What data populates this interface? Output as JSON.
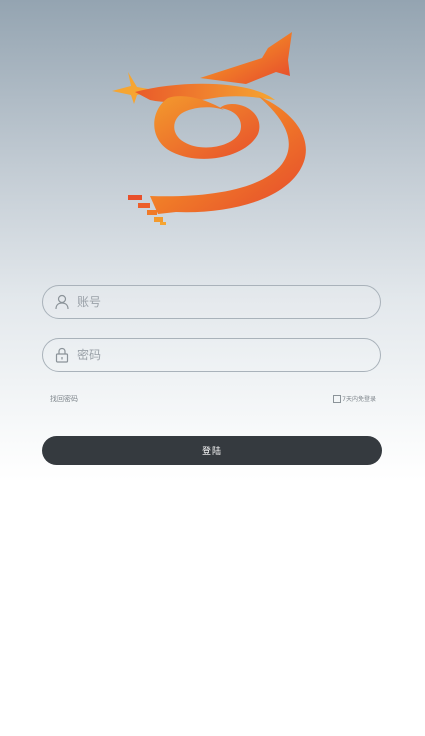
{
  "logo": {
    "icon": "swirl-star-logo",
    "colors": [
      "#f7a230",
      "#ef6a2a",
      "#e8492c"
    ]
  },
  "form": {
    "account": {
      "placeholder": "账号",
      "value": "",
      "icon": "user-icon"
    },
    "password": {
      "placeholder": "密码",
      "value": "",
      "icon": "lock-icon"
    },
    "forgot_label": "找回密码",
    "remember_label": "7天内免登录",
    "remember_checked": false,
    "login_label": "登陆"
  },
  "colors": {
    "button_bg": "#353a3f",
    "field_border": "#a9b2ba"
  }
}
